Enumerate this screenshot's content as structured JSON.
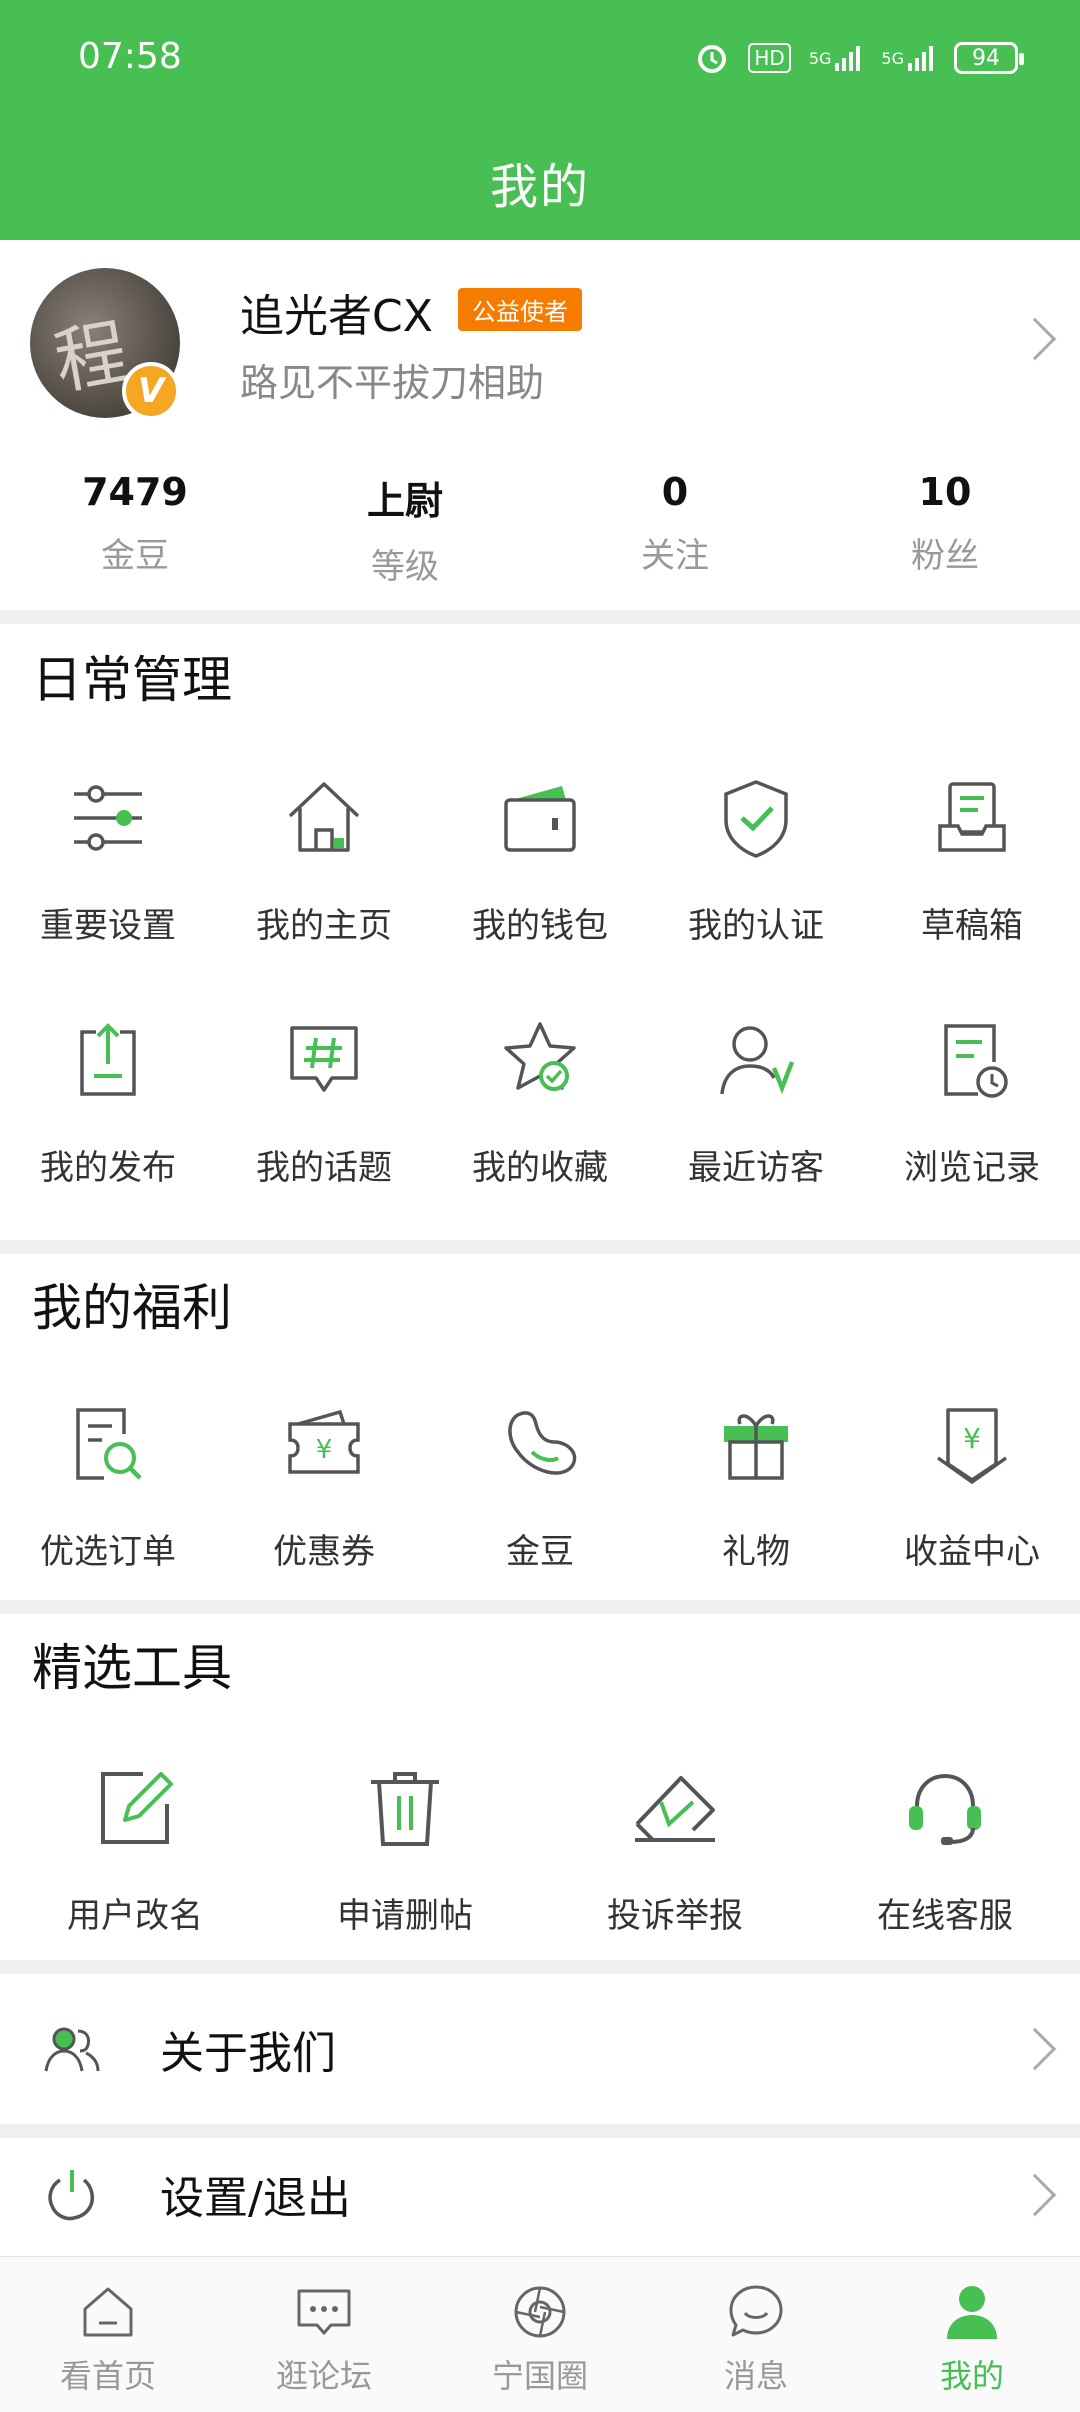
{
  "status": {
    "time": "07:58",
    "battery": "94",
    "signal1": "5G",
    "signal2": "5G",
    "hd": "HD"
  },
  "header": {
    "title": "我的"
  },
  "profile": {
    "name": "追光者CX",
    "badge": "公益使者",
    "signature": "路见不平拔刀相助",
    "avatar_glyph": "程",
    "vip": "V",
    "stats": [
      {
        "value": "7479",
        "label": "金豆"
      },
      {
        "value": "上尉",
        "label": "等级"
      },
      {
        "value": "0",
        "label": "关注"
      },
      {
        "value": "10",
        "label": "粉丝"
      }
    ]
  },
  "daily": {
    "title": "日常管理",
    "row1": [
      {
        "label": "重要设置",
        "icon": "sliders-icon"
      },
      {
        "label": "我的主页",
        "icon": "home-icon"
      },
      {
        "label": "我的钱包",
        "icon": "wallet-icon"
      },
      {
        "label": "我的认证",
        "icon": "shield-check-icon"
      },
      {
        "label": "草稿箱",
        "icon": "drafts-icon"
      }
    ],
    "row2": [
      {
        "label": "我的发布",
        "icon": "upload-icon"
      },
      {
        "label": "我的话题",
        "icon": "topic-icon"
      },
      {
        "label": "我的收藏",
        "icon": "star-icon"
      },
      {
        "label": "最近访客",
        "icon": "visitor-icon"
      },
      {
        "label": "浏览记录",
        "icon": "history-icon"
      }
    ]
  },
  "welfare": {
    "title": "我的福利",
    "items": [
      {
        "label": "优选订单",
        "icon": "order-search-icon"
      },
      {
        "label": "优惠券",
        "icon": "coupon-icon"
      },
      {
        "label": "金豆",
        "icon": "bean-icon"
      },
      {
        "label": "礼物",
        "icon": "gift-icon"
      },
      {
        "label": "收益中心",
        "icon": "income-icon"
      }
    ]
  },
  "tools": {
    "title": "精选工具",
    "items": [
      {
        "label": "用户改名",
        "icon": "edit-icon"
      },
      {
        "label": "申请删帖",
        "icon": "trash-icon"
      },
      {
        "label": "投诉举报",
        "icon": "report-icon"
      },
      {
        "label": "在线客服",
        "icon": "headset-icon"
      }
    ]
  },
  "list": [
    {
      "label": "关于我们",
      "icon": "users-icon"
    },
    {
      "label": "设置/退出",
      "icon": "power-icon"
    }
  ],
  "tabs": [
    {
      "label": "看首页",
      "icon": "home-tab-icon"
    },
    {
      "label": "逛论坛",
      "icon": "forum-tab-icon"
    },
    {
      "label": "宁国圈",
      "icon": "circle-tab-icon"
    },
    {
      "label": "消息",
      "icon": "message-tab-icon"
    },
    {
      "label": "我的",
      "icon": "me-tab-icon",
      "active": true
    }
  ],
  "colors": {
    "accent": "#47bf52",
    "badge": "#f57c00",
    "vip": "#f5a623"
  }
}
